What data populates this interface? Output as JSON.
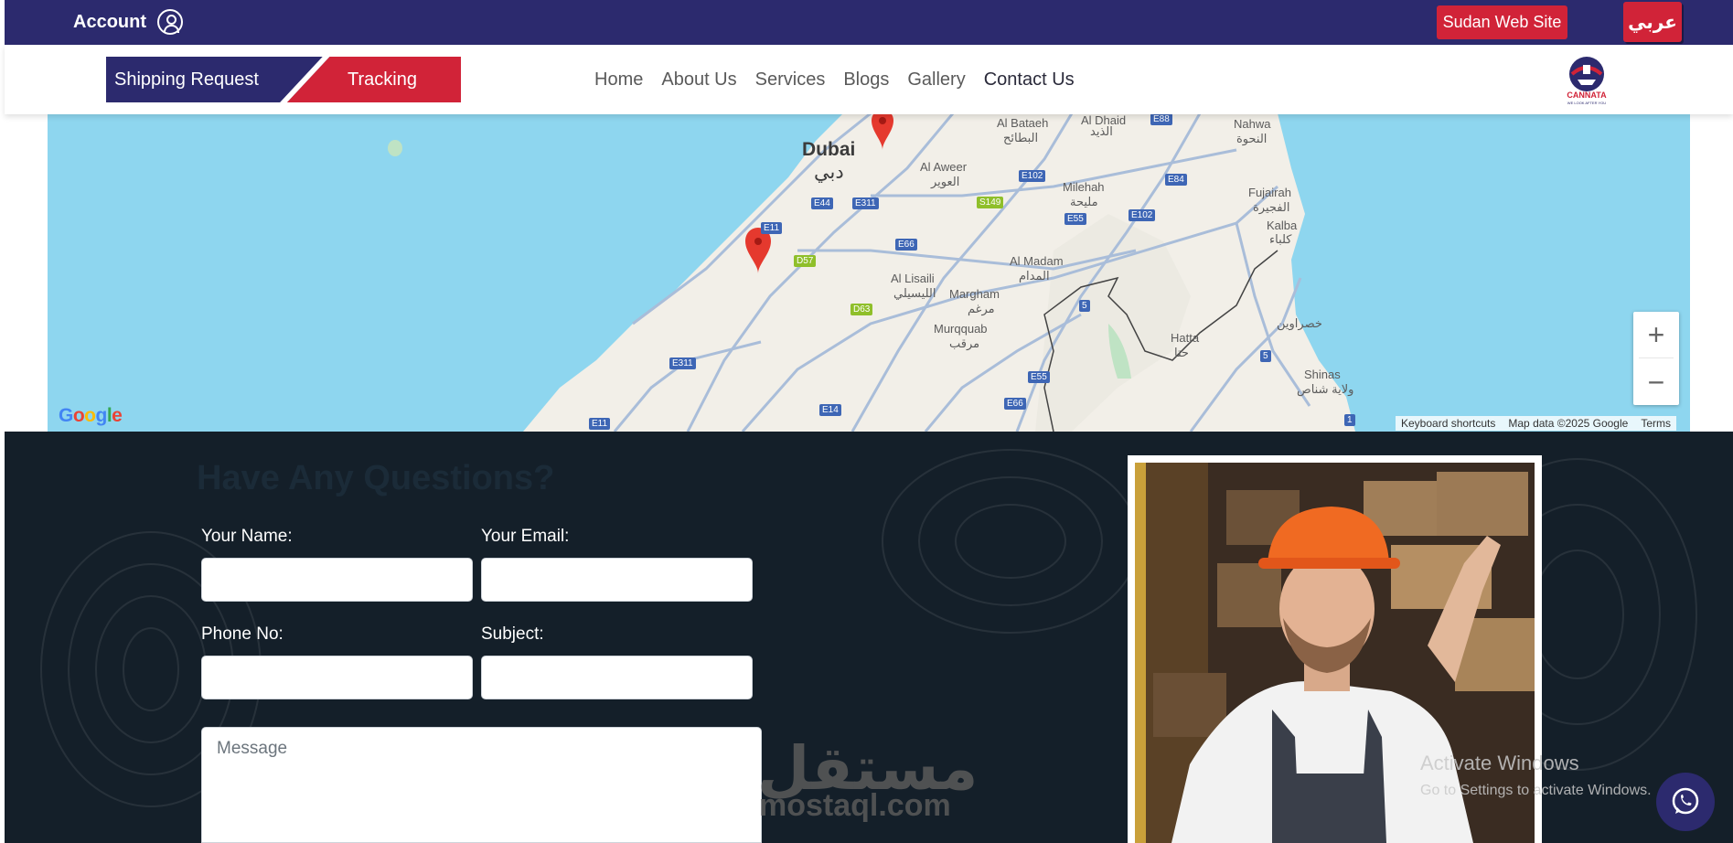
{
  "topbar": {
    "account_label": "Account",
    "sudan_button": "Sudan Web Site",
    "language_button": "عربي"
  },
  "nav": {
    "shipping_request": "Shipping Request",
    "tracking": "Tracking",
    "links": [
      "Home",
      "About Us",
      "Services",
      "Blogs",
      "Gallery",
      "Contact Us"
    ],
    "active_link": "Contact Us",
    "logo_text": "CANNATA",
    "logo_tagline": "WE LOOK AFTER YOU"
  },
  "map": {
    "labels": {
      "dubai_en": "Dubai",
      "dubai_ar": "دبي",
      "al_bataeh_en": "Al Bataeh",
      "al_bataeh_ar": "البطائح",
      "al_dhaid_en": "Al Dhaid",
      "al_dhaid_ar": "الذيد",
      "nahwa_en": "Nahwa",
      "nahwa_ar": "النحوة",
      "al_aweer_en": "Al Aweer",
      "al_aweer_ar": "العوير",
      "milehah_en": "Milehah",
      "milehah_ar": "مليحة",
      "fujairah_en": "Fujairah",
      "fujairah_ar": "الفجيرة",
      "kalba_en": "Kalba",
      "kalba_ar": "كلباء",
      "al_madam_en": "Al Madam",
      "al_madam_ar": "المدام",
      "al_lisaili_en": "Al Lisaili",
      "al_lisaili_ar": "الليسيلي",
      "margham_en": "Margham",
      "margham_ar": "مرغم",
      "murqquab_en": "Murqquab",
      "murqquab_ar": "مرقب",
      "hatta_en": "Hatta",
      "hatta_ar": "حتا",
      "khasawain_ar": "خصراوين",
      "shinas_en": "Shinas",
      "shinas_ar": "ولاية شناص"
    },
    "road_signs": [
      "E88",
      "E84",
      "E102",
      "S149",
      "E44",
      "E311",
      "E11",
      "D57",
      "E66",
      "E55",
      "E102",
      "5",
      "D63",
      "5",
      "E311",
      "E55",
      "E66",
      "E14",
      "E11",
      "1"
    ],
    "zoom_in": "+",
    "zoom_out": "−",
    "google_logo": "Google",
    "footer": {
      "shortcuts": "Keyboard shortcuts",
      "map_data": "Map data ©2025 Google",
      "terms": "Terms"
    }
  },
  "contact": {
    "heading": "Have Any Questions?",
    "name_label": "Your Name:",
    "email_label": "Your Email:",
    "phone_label": "Phone No:",
    "subject_label": "Subject:",
    "message_placeholder": "Message"
  },
  "overlay": {
    "watermark_ar": "مستقل",
    "watermark_en": "mostaql.com",
    "activate_title": "Activate Windows",
    "activate_sub": "Go to Settings to activate Windows."
  },
  "colors": {
    "brand_blue": "#2c2a6e",
    "brand_red": "#d12338",
    "dark_bg": "#141f29",
    "map_water": "#8ed6ef",
    "map_land": "#f2efe8"
  }
}
